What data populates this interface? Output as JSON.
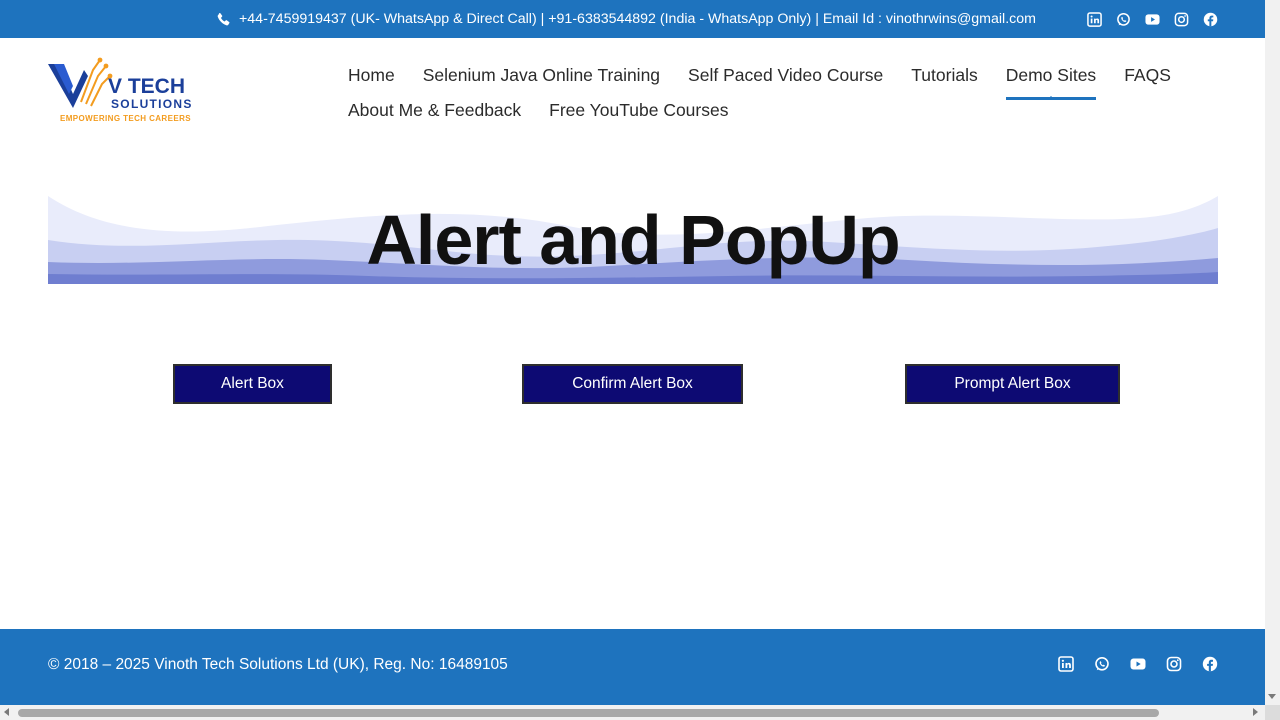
{
  "topbar": {
    "contact_text": "+44-7459919437 (UK- WhatsApp & Direct Call) | +91-6383544892 (India - WhatsApp Only) | Email Id : vinothrwins@gmail.com",
    "background_color": "#1e73be",
    "social_icons": [
      "linkedin-icon",
      "whatsapp-icon",
      "youtube-icon",
      "instagram-icon",
      "facebook-icon"
    ]
  },
  "logo": {
    "name": "V TECH",
    "subtitle": "SOLUTIONS",
    "tagline": "EMPOWERING TECH CAREERS"
  },
  "nav": {
    "row1": [
      "Home",
      "Selenium Java Online Training",
      "Self Paced Video Course",
      "Tutorials",
      "Demo Sites",
      "FAQS"
    ],
    "row2": [
      "About Me & Feedback",
      "Free YouTube Courses"
    ],
    "active": "Demo Sites"
  },
  "banner": {
    "title": "Alert and PopUp"
  },
  "buttons": {
    "alert": "Alert Box",
    "confirm": "Confirm Alert Box",
    "prompt": "Prompt Alert Box",
    "color": "#0d0a73"
  },
  "footer": {
    "copyright": "© 2018 – 2025 Vinoth Tech Solutions Ltd (UK), Reg. No: 16489105",
    "social_icons": [
      "linkedin-icon",
      "whatsapp-icon",
      "youtube-icon",
      "instagram-icon",
      "facebook-icon"
    ]
  }
}
